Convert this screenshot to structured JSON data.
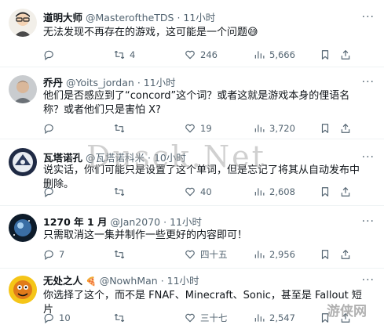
{
  "tweets": [
    {
      "name": "道明大师",
      "handle": "@MasteroftheTDS",
      "sep": "·",
      "time": "11小时",
      "text": "无法发现不再存在的游戏，这可能是一个问题😅",
      "replies": "",
      "retweets": "4",
      "likes": "246",
      "views": "5,666"
    },
    {
      "name": "乔丹",
      "handle": "@Yoits_jordan",
      "sep": "·",
      "time": "11小时",
      "text": "他们是否感应到了“concord”这个词？或者这就是游戏本身的俚语名称？或者他们只是害怕 X?",
      "replies": "",
      "retweets": "",
      "likes": "19",
      "views": "3,720"
    },
    {
      "name": "瓦塔诺孔",
      "handle": "@瓦塔诺科米",
      "sep": "·",
      "time": "10小时",
      "text": "说实话，你们可能只是设置了这个单词，但是忘记了将其从自动发布中删除。",
      "replies": "",
      "retweets": "",
      "likes": "40",
      "views": "2,608"
    },
    {
      "name": "1270 年 1 月",
      "handle": "@Jan2070",
      "sep": "·",
      "time": "11小时",
      "text": "只需取消这一集并制作一些更好的内容即可！",
      "replies": "7",
      "retweets": "",
      "likes": "四十五",
      "views": "2,956"
    },
    {
      "name": "无处之人",
      "name_emoji": "🍕",
      "handle": "@NowhMan",
      "sep": "·",
      "time": "11小时",
      "text": "你选择了这个，而不是 FNAF、Minecraft、Sonic，甚至是 Fallout 短片",
      "replies": "10",
      "retweets": "",
      "likes": "三十七",
      "views": "2,547"
    }
  ],
  "more_label": "···",
  "watermark": "Dusck.Net",
  "watermark_corner": "游侠网",
  "icons": {
    "reply": "reply-icon",
    "retweet": "retweet-icon",
    "like": "heart-icon",
    "views": "views-icon",
    "bookmark": "bookmark-icon",
    "share": "share-icon"
  },
  "colors": {
    "text": "#0f1419",
    "secondary": "#536471",
    "divider": "#eff3f4"
  }
}
